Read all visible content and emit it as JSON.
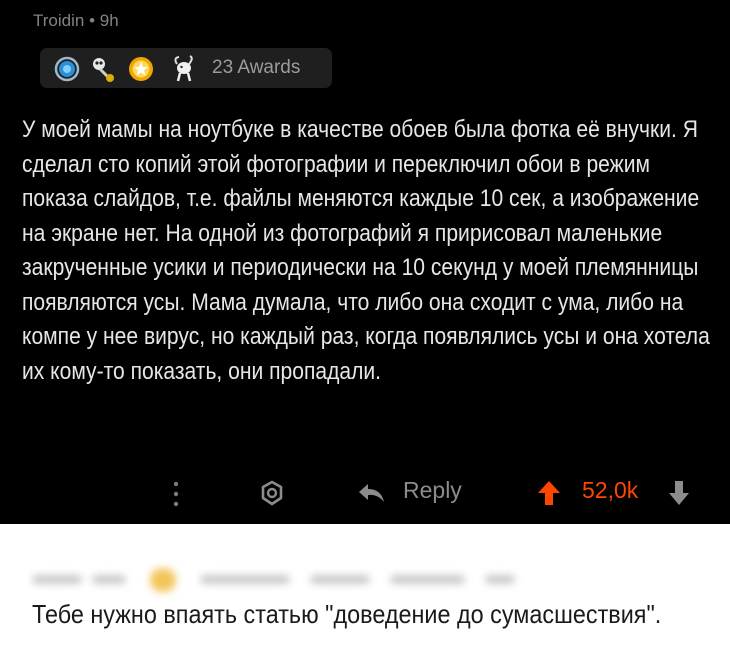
{
  "comment": {
    "author": "Troidin",
    "separator": "•",
    "age": "9h",
    "awards": {
      "icons": [
        "helpful-award-icon",
        "skull-award-icon",
        "wholesome-award-icon",
        "goat-award-icon"
      ],
      "count_label": "23 Awards"
    },
    "body": "У моей мамы на ноутбуке в качестве обоев была фотка её внучки. Я сделал сто копий этой фотографии и переключил обои в режим показа слайдов, т.е. файлы меняются каждые 10 сек, а изображение на экране нет. На одной из фотографий я пририсовал маленькие закрученные усики и периодически на 10 секунд у моей племянницы появляются усы. Мама думала, что либо она сходит с ума, либо на компе у нее вирус, но каждый раз, когда появлялись усы и она хотела их кому-то показать, они пропадали.",
    "actions": {
      "reply_label": "Reply",
      "score": "52,0k"
    }
  },
  "reply_comment": {
    "text": "Тебе нужно впаять статью \"доведение до сумасшествия\"."
  },
  "colors": {
    "upvote": "#ff4500",
    "muted": "#818384",
    "dark_bg": "#000000",
    "light_bg": "#ffffff"
  }
}
